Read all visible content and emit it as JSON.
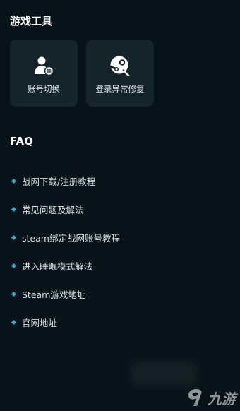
{
  "tools": {
    "title": "游戏工具",
    "cards": [
      {
        "label": "账号切换",
        "icon": "user-switch-icon"
      },
      {
        "label": "登录异常修复",
        "icon": "steam-wrench-icon"
      }
    ]
  },
  "faq": {
    "title": "FAQ",
    "items": [
      "战网下载/注册教程",
      "常见问题及解法",
      "steam绑定战网账号教程",
      "进入睡眠模式解法",
      "Steam游戏地址",
      "官网地址"
    ]
  },
  "watermark": {
    "text": "九游"
  },
  "colors": {
    "background": "#071319",
    "card": "#15242b",
    "accent": "#2fb0d8"
  }
}
